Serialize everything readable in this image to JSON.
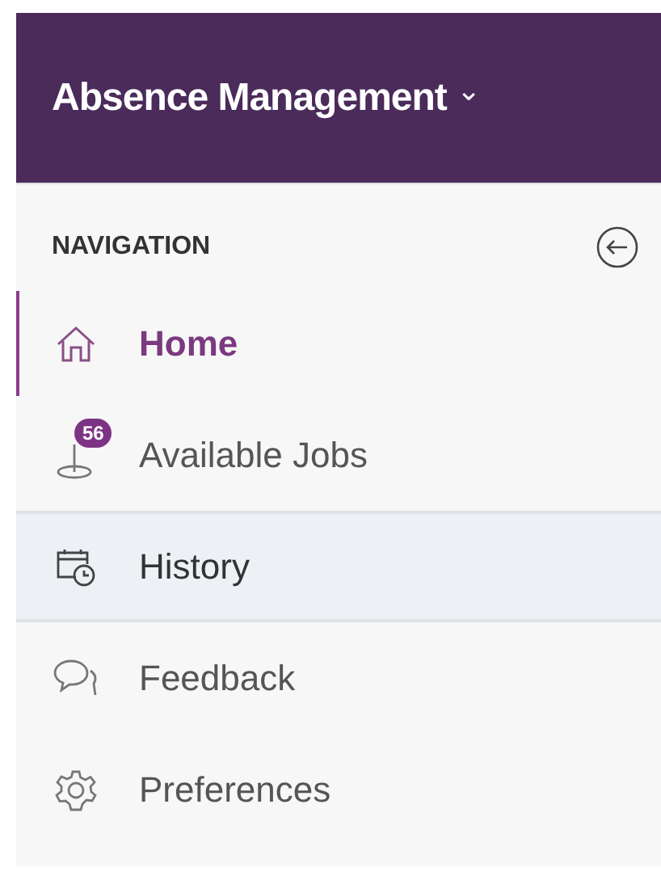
{
  "header": {
    "title": "Absence Management",
    "caret": "⌄"
  },
  "navigation": {
    "heading": "NAVIGATION",
    "items": [
      {
        "label": "Home",
        "selected": true,
        "highlighted": false
      },
      {
        "label": "Available Jobs",
        "selected": false,
        "highlighted": false,
        "badge": "56"
      },
      {
        "label": "History",
        "selected": false,
        "highlighted": true
      },
      {
        "label": "Feedback",
        "selected": false,
        "highlighted": false
      },
      {
        "label": "Preferences",
        "selected": false,
        "highlighted": false
      }
    ]
  }
}
